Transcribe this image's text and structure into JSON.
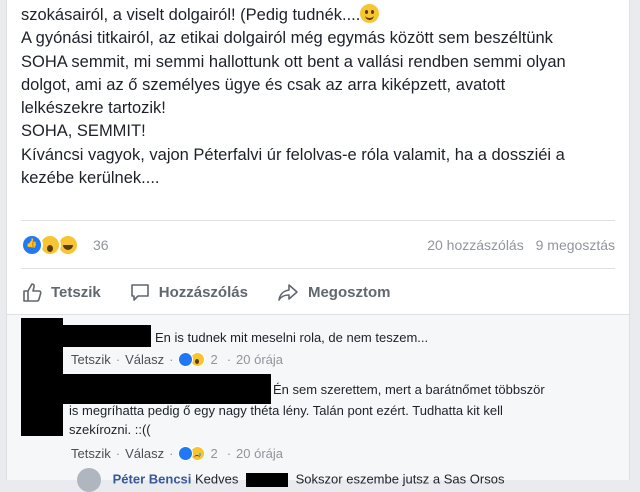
{
  "post": {
    "lines": [
      "szokásairól, a viselt dolgairól! (Pedig tudnék....",
      "A gyónási titkairól, az etikai dolgairól még egymás között sem beszéltünk",
      "SOHA semmit, mi semmi hallottunk ott bent a vallási rendben semmi olyan",
      "dolgot, ami az ő személyes ügye és csak az arra kiképzett, avatott",
      "lelkészekre tartozik!",
      "SOHA, SEMMIT!",
      "Kíváncsi vagyok, vajon Péterfalvi úr felolvas-e róla valamit, ha a dossziéi a",
      "kezébe kerülnek...."
    ],
    "smiley_icon": "smiley-emoji"
  },
  "stats": {
    "reaction_count": "36",
    "comments": "20 hozzászólás",
    "shares": "9 megosztás"
  },
  "actions": {
    "like": "Tetszik",
    "comment": "Hozzászólás",
    "share": "Megosztom"
  },
  "comments": [
    {
      "text": "En is tudnek mit meselni rola, de nem teszem...",
      "like_label": "Tetszik",
      "reply_label": "Válasz",
      "reaction_count": "2",
      "time": "20 órája"
    },
    {
      "text_lines": [
        "Én sem szerettem, mert a barátnőmet többször",
        "is megríhatta pedig ő egy nagy théta lény. Talán pont ezért. Tudhatta kit kell",
        "szekírozni. ::(("
      ],
      "like_label": "Tetszik",
      "reply_label": "Válasz",
      "reaction_count": "2",
      "time": "20 órája"
    }
  ],
  "reply_preview": {
    "name": "Péter Bencsi",
    "text": "Kedves",
    "rest": "Sokszor eszembe jutsz a Sas Orsos"
  },
  "colors": {
    "link": "#365899",
    "secondary": "#90949c",
    "like_blue": "#2078f4",
    "emoji_yellow": "#f7c531"
  }
}
